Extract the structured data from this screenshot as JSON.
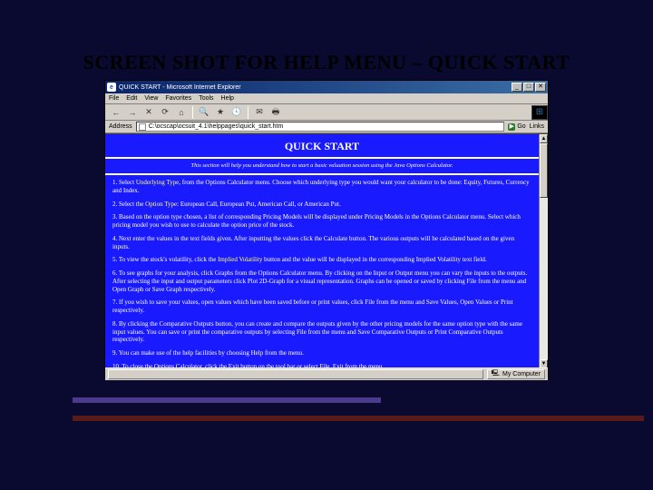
{
  "slide_title": "SCREEN SHOT FOR HELP MENU – QUICK START",
  "window": {
    "title": "QUICK START - Microsoft Internet Explorer",
    "min": "_",
    "max": "□",
    "close": "✕"
  },
  "menus": [
    "File",
    "Edit",
    "View",
    "Favorites",
    "Tools",
    "Help"
  ],
  "toolbar_icons": {
    "back": "←",
    "forward": "→",
    "stop": "✕",
    "refresh": "⟳",
    "home": "⌂",
    "search": "🔍",
    "favorites": "★",
    "history": "🕓",
    "mail": "✉",
    "print": "🖶",
    "throbber": "⊞"
  },
  "address": {
    "label": "Address",
    "value": "C:\\ocscap\\ocsuit_4.1\\helppages\\quick_start.htm",
    "go": "Go",
    "links": "Links"
  },
  "page": {
    "title": "QUICK START",
    "intro": "This section will help you understand how to start a basic valuation session using the Java Options Calculator.",
    "items": [
      {
        "pre": "Select ",
        "link": "Underlying Type",
        "post": ", from the Options Calculator menu. Choose which underlying type you would want your calculator to be done: Equity, Futures, Currency and Index."
      },
      {
        "pre": "Select the ",
        "link": "Option Type",
        "post": ": European Call, European Put, American Call, or American Put."
      },
      {
        "pre": "",
        "link": "",
        "post": "Based on the option type chosen, a list of corresponding Pricing Models will be displayed under Pricing Models in the Options Calculator menu. Select which pricing model you wish to use to calculate the option price of the stock."
      },
      {
        "pre": "",
        "link": "",
        "post": "Next enter the values in the text fields given. After inputting the values click the Calculate button. The various outputs will be calculated based on the given inputs."
      },
      {
        "pre": "To view the stock's volatility, click the ",
        "link": "Implied Volatility",
        "post": " button and the value will be displayed in the corresponding Implied Volatility text field."
      },
      {
        "pre": "",
        "link": "",
        "post": "To see graphs for your analysis, click Graphs from the Options Calculator menu. By clicking on the Input or Output menu you can vary the inputs to the outputs. After selecting the input and output parameters click Plot 2D-Graph for a visual representation. Graphs can be opened or saved by clicking File from the menu and Open Graph or Save Graph respectively."
      },
      {
        "pre": "",
        "link": "",
        "post": "If you wish to save your values, open values which have been saved before or print values, click File from the menu and Save Values, Open Values or Print respectively."
      },
      {
        "pre": "",
        "link": "",
        "post": "By clicking the Comparative Outputs button, you can create and compare the outputs given by the other pricing models for the same option type with the same input values. You can save or print the comparative outputs by selecting File from the menu and Save Comparative Outputs or Print Comparative Outputs respectively."
      },
      {
        "pre": "",
        "link": "",
        "post": "You can make use of the help facilities by choosing Help from the menu."
      },
      {
        "pre": "",
        "link": "",
        "post": "To close the Options Calculator, click the Exit button on the tool bar or select File, Exit from the menu."
      }
    ]
  },
  "status": {
    "left": "",
    "zone": "My Computer"
  }
}
